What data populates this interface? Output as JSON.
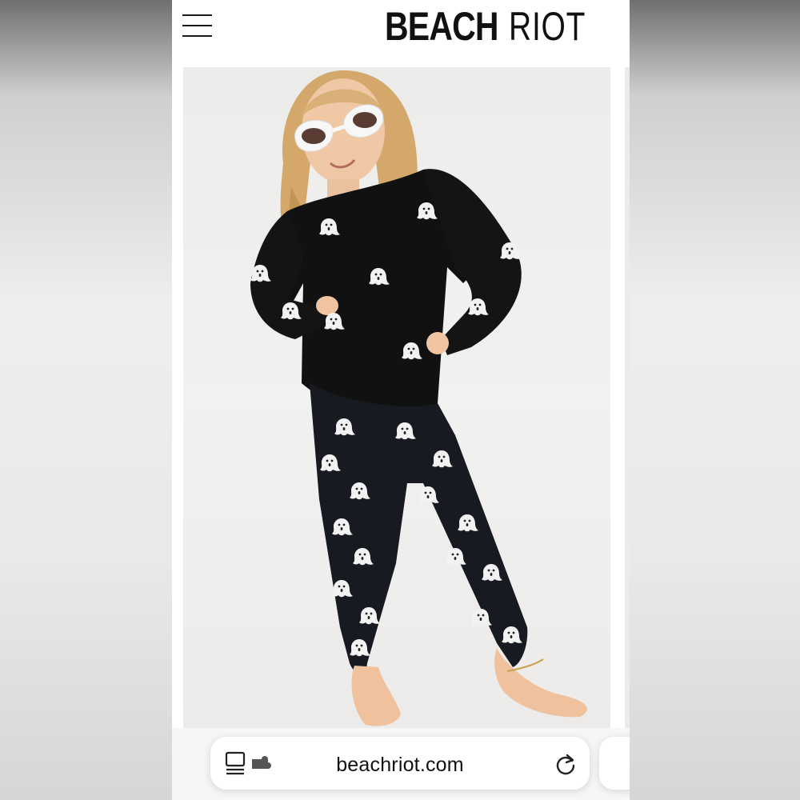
{
  "header": {
    "menu_icon": "hamburger-menu-icon",
    "logo": {
      "bold": "BEACH",
      "thin": "RIOT"
    }
  },
  "product_image": {
    "subject": "girl-in-ghost-print-sweater-and-leggings",
    "background_color": "#ececea",
    "garment_color": "#111111",
    "print_color": "#f2f2f2"
  },
  "address_bar": {
    "url": "beachriot.com",
    "left_icon": "tab-overview-icon",
    "right_icon": "reload-icon"
  },
  "colors": {
    "page_background": "#ffffff",
    "text": "#111111",
    "address_bar_background": "#f6f6f6"
  }
}
